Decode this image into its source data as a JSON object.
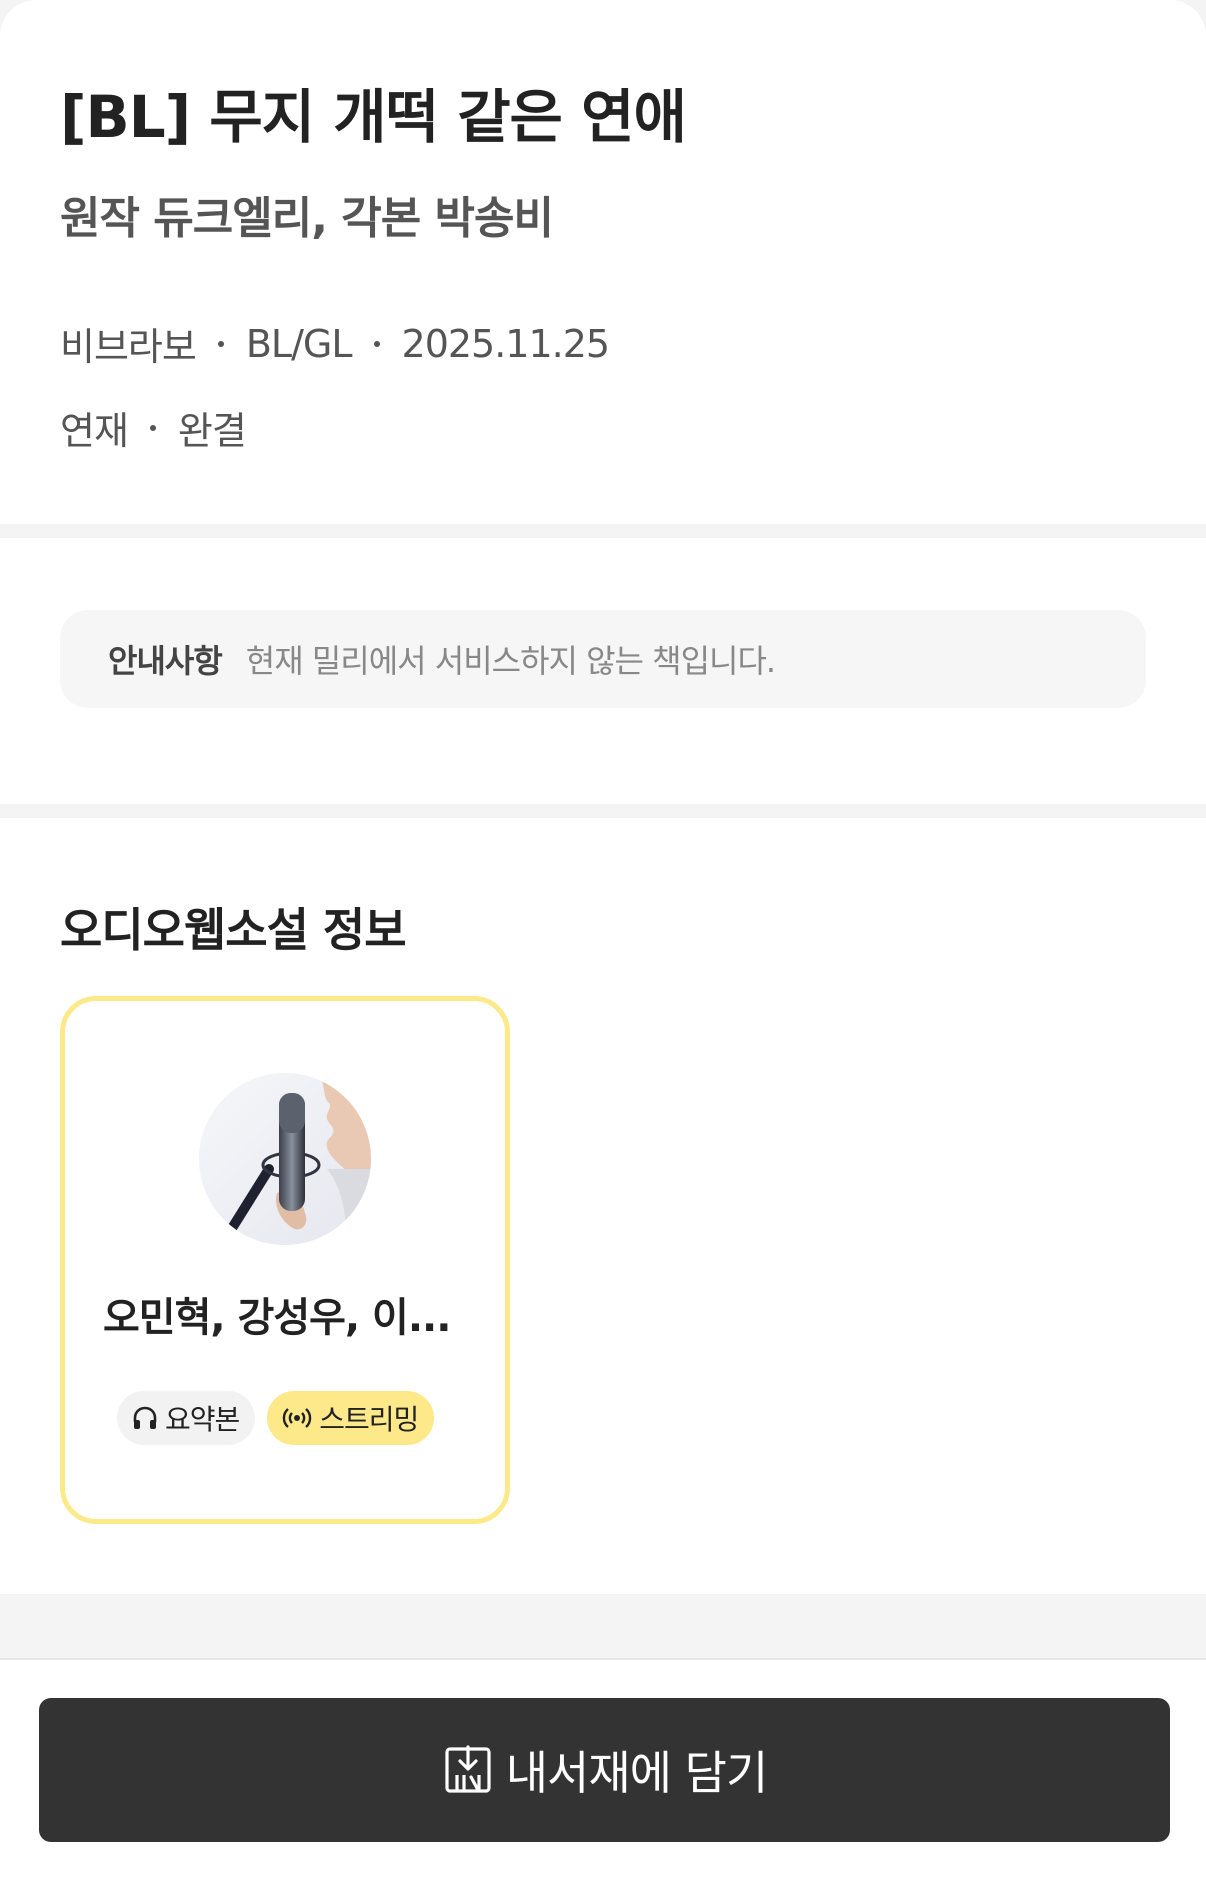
{
  "book": {
    "title": "[BL] 무지 개떡 같은 연애",
    "credit": "원작 듀크엘리, 각본 박송비",
    "publisher": "비브라보",
    "genre": "BL/GL",
    "date": "2025.11.25",
    "type": "연재",
    "status": "완결"
  },
  "notice": {
    "label": "안내사항",
    "text": "현재 밀리에서 서비스하지 않는 책입니다."
  },
  "audio_section": {
    "title": "오디오웹소설 정보",
    "items": [
      {
        "narrators": "오민혁, 강성우, 이...",
        "thumbnail": "microphone-singer-photo",
        "tags": [
          {
            "label": "요약본",
            "icon": "headphones-icon"
          },
          {
            "label": "스트리밍",
            "icon": "broadcast-icon"
          }
        ]
      }
    ]
  },
  "bottom_bar": {
    "add_label": "내서재에 담기",
    "add_icon": "add-to-shelf-icon"
  },
  "colors": {
    "accent_yellow": "#fbe98a",
    "button_dark": "#333333",
    "page_bg": "#f4f4f4"
  }
}
